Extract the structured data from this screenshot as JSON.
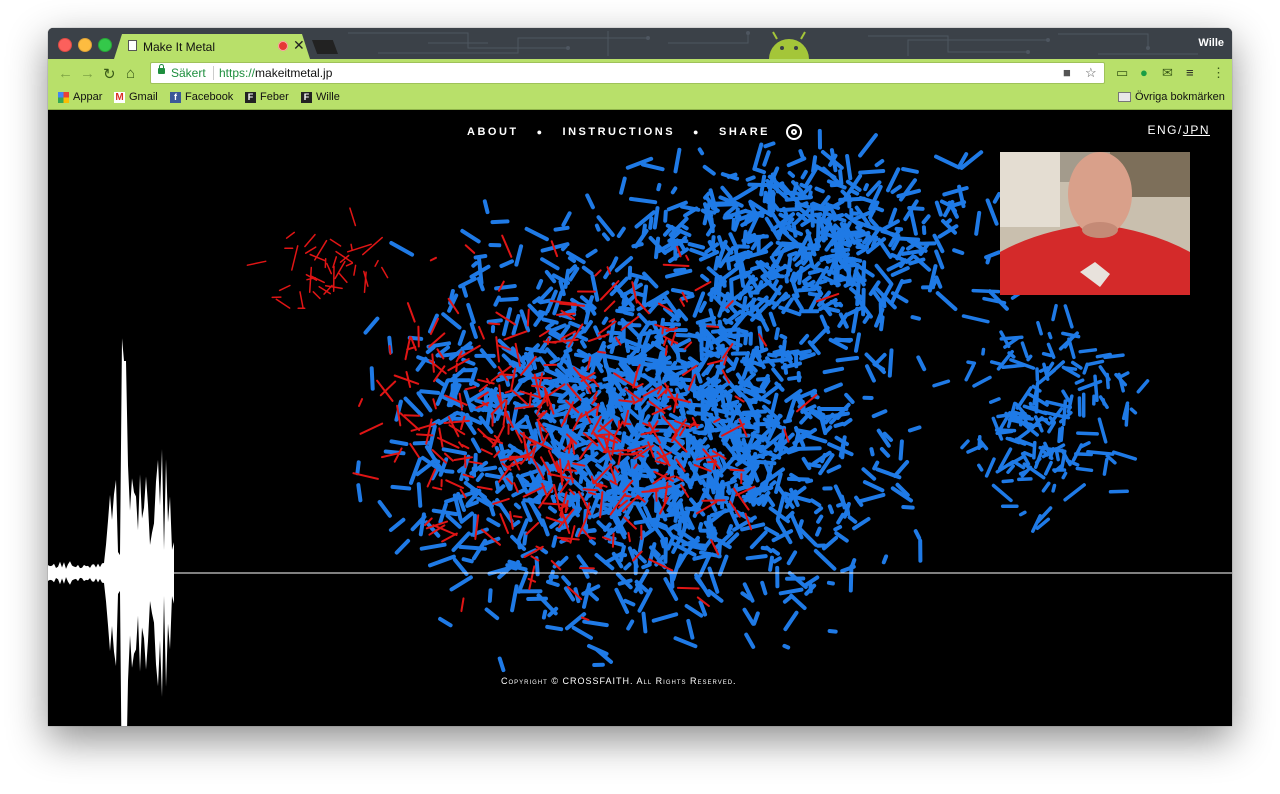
{
  "tab": {
    "title": "Make It Metal"
  },
  "profile": {
    "name": "Wille"
  },
  "address": {
    "secure_label": "Säkert",
    "scheme": "https://",
    "host": "makeitmetal.jp"
  },
  "bookmarks": [
    {
      "label": "Appar",
      "icon": "apps-icon"
    },
    {
      "label": "Gmail",
      "icon": "gmail-icon"
    },
    {
      "label": "Facebook",
      "icon": "facebook-icon"
    },
    {
      "label": "Feber",
      "icon": "feber-icon"
    },
    {
      "label": "Wille",
      "icon": "feber-icon"
    }
  ],
  "other_bookmarks": "Övriga bokmärken",
  "site": {
    "nav": {
      "about": "ABOUT",
      "instructions": "INSTRUCTIONS",
      "share": "SHARE"
    },
    "lang": {
      "eng": "ENG",
      "sep": "/",
      "jpn": "JPN"
    },
    "copyright": "Copyright © CROSSFAITH. All Rights Reserved."
  },
  "colors": {
    "chrome": "#b8e06a",
    "tabstrip": "#3b4148",
    "stroke_blue": "#1f7ae6",
    "stroke_red": "#e01515",
    "background": "#000000"
  }
}
